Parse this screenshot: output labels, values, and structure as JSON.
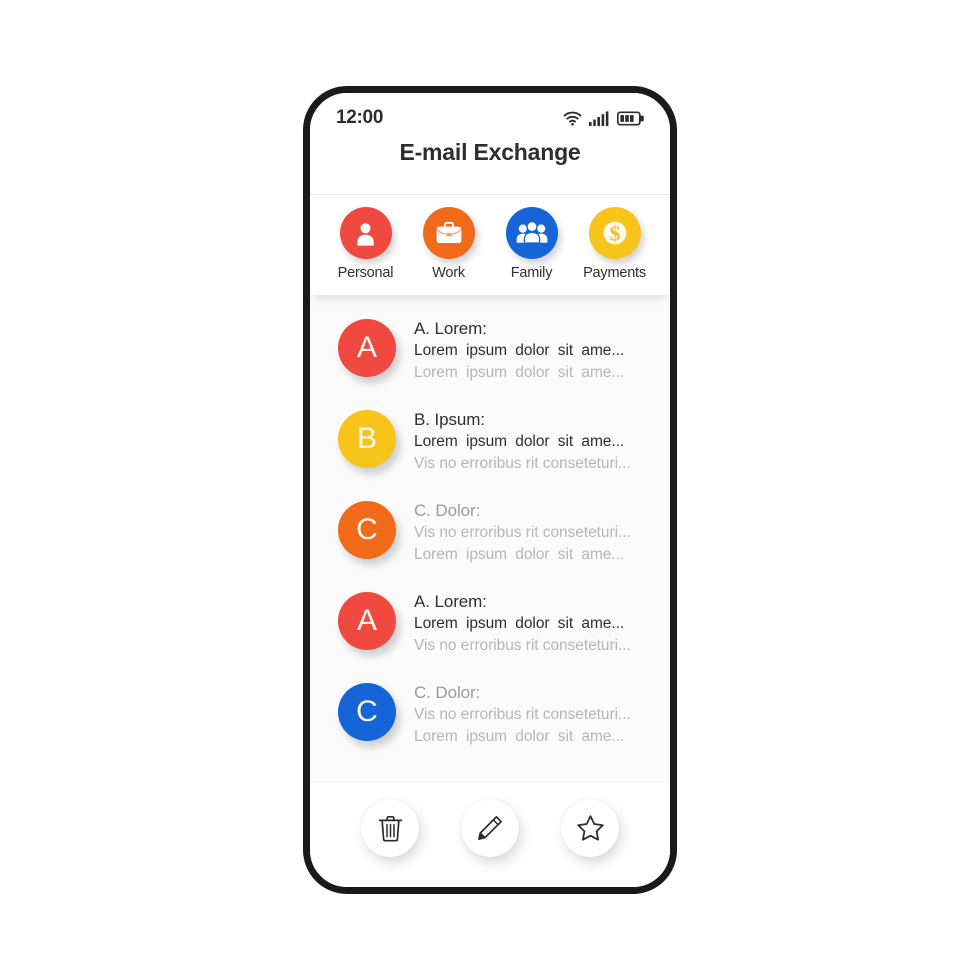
{
  "phone": {
    "status_bar": {
      "time": "12:00",
      "icons": [
        "wifi-icon",
        "cellular-signal-icon",
        "battery-icon"
      ],
      "battery_level_segments": 3,
      "signal_bars": 5
    },
    "app_title": "E-mail Exchange"
  },
  "categories": [
    {
      "label": "Personal",
      "icon": "person-icon",
      "color": "#F04A40"
    },
    {
      "label": "Work",
      "icon": "briefcase-icon",
      "color": "#F06A1A"
    },
    {
      "label": "Family",
      "icon": "people-icon",
      "color": "#1565D8"
    },
    {
      "label": "Payments",
      "icon": "dollar-coin-icon",
      "color": "#F7C41B"
    }
  ],
  "mail_list": [
    {
      "avatar_letter": "A",
      "avatar_color": "#F04A40",
      "sender": "A. Lorem:",
      "line1": "Lorem ipsum dolor sit ame...",
      "line2": "Lorem ipsum dolor sit ame...",
      "unread": true
    },
    {
      "avatar_letter": "B",
      "avatar_color": "#F7C41B",
      "sender": "B. Ipsum:",
      "line1": "Lorem ipsum dolor sit ame...",
      "line2": "Vis no erroribus rit conseteturi...",
      "unread": true
    },
    {
      "avatar_letter": "C",
      "avatar_color": "#F06A1A",
      "sender": "C. Dolor:",
      "line1": "Vis no erroribus rit conseteturi...",
      "line2": "Lorem ipsum dolor sit ame...",
      "unread": false
    },
    {
      "avatar_letter": "A",
      "avatar_color": "#F04A40",
      "sender": "A. Lorem:",
      "line1": "Lorem ipsum dolor sit ame...",
      "line2": "Vis no erroribus rit conseteturi...",
      "unread": true
    },
    {
      "avatar_letter": "C",
      "avatar_color": "#1565D8",
      "sender": "C. Dolor:",
      "line1": "Vis no erroribus rit conseteturi...",
      "line2": "Lorem ipsum dolor sit ame...",
      "unread": false
    }
  ],
  "actions": [
    {
      "name": "delete-button",
      "icon": "trash-icon"
    },
    {
      "name": "compose-button",
      "icon": "pencil-icon"
    },
    {
      "name": "favorite-button",
      "icon": "star-icon"
    }
  ],
  "colors": {
    "red": "#F04A40",
    "orange": "#F06A1A",
    "yellow": "#F7C41B",
    "blue": "#1565D8",
    "text_dark": "#2e2e2e",
    "text_gray": "#b6b6b6",
    "frame": "#1a1a1a"
  }
}
